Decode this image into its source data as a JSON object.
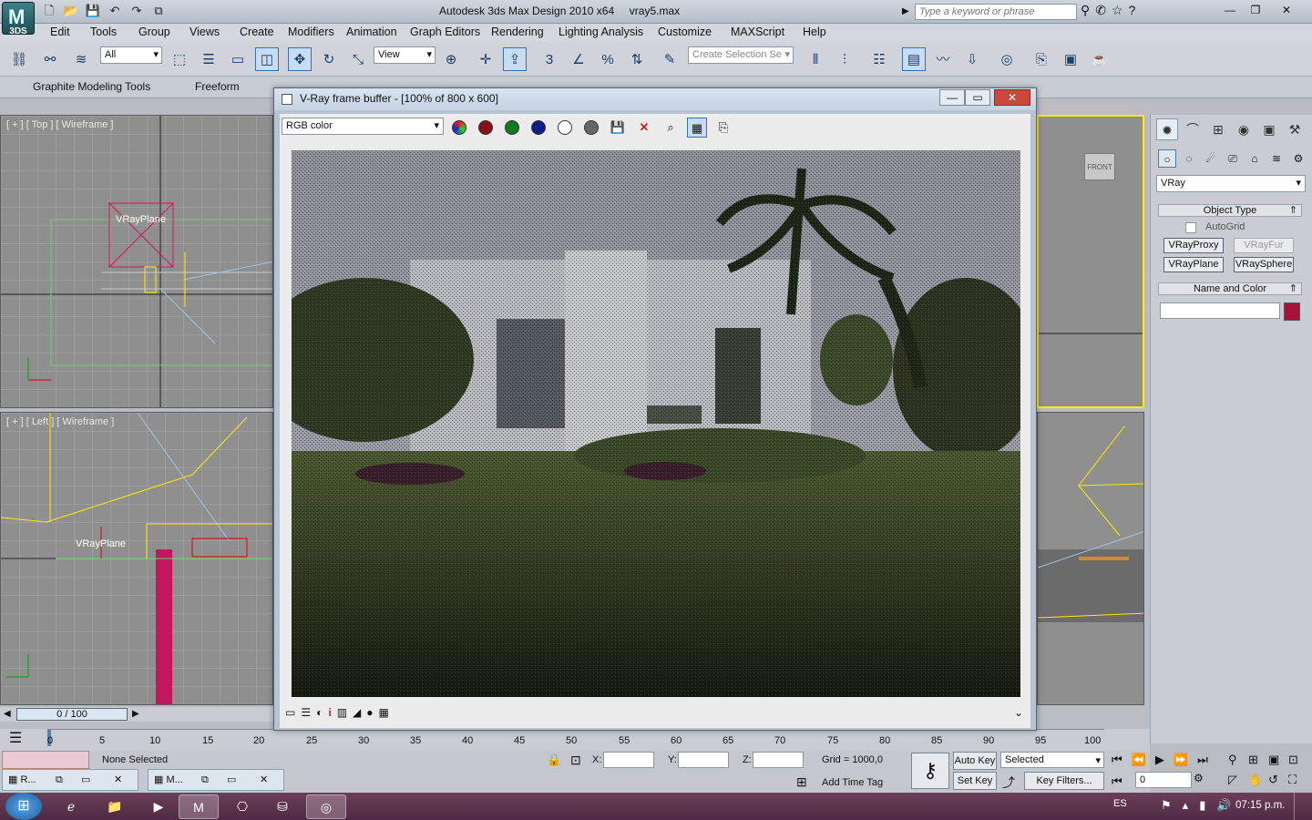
{
  "app": {
    "title": "Autodesk 3ds Max Design 2010 x64",
    "file": "vray5.max",
    "logo_text": "3DS",
    "search_placeholder": "Type a keyword or phrase"
  },
  "menus": [
    "Edit",
    "Tools",
    "Group",
    "Views",
    "Create",
    "Modifiers",
    "Animation",
    "Graph Editors",
    "Rendering",
    "Lighting Analysis",
    "Customize",
    "MAXScript",
    "Help"
  ],
  "toolbar": {
    "selection_filter": "All",
    "ref_coord": "View",
    "named_selection_placeholder": "Create Selection Se",
    "snap_label": "3"
  },
  "ribbon": {
    "tabs": [
      "Graphite Modeling Tools",
      "Freeform"
    ]
  },
  "viewports": {
    "top_label": "[ + ] [ Top ] [ Wireframe ]",
    "left_label": "[ + ] [ Left ] [ Wireframe ]",
    "object_label": "VRayPlane",
    "viewcube_label": "FRONT"
  },
  "vfb": {
    "title": "V-Ray frame buffer - [100% of 800 x 600]",
    "channel": "RGB color",
    "colors": {
      "red": "#8a0f1a",
      "green": "#0f7a1f",
      "blue": "#0f1f8a"
    }
  },
  "command_panel": {
    "renderer_dropdown": "VRay",
    "object_type_header": "Object Type",
    "autogrid": "AutoGrid",
    "buttons": [
      "VRayProxy",
      "VRayFur",
      "VRayPlane",
      "VRaySphere"
    ],
    "name_color_header": "Name and Color",
    "object_color": "#a5123a"
  },
  "timeline": {
    "frame_display": "0 / 100",
    "ticks": [
      "0",
      "5",
      "10",
      "15",
      "20",
      "25",
      "30",
      "35",
      "40",
      "45",
      "50",
      "55",
      "60",
      "65",
      "70",
      "75",
      "80",
      "85",
      "90",
      "95",
      "100"
    ]
  },
  "status": {
    "selection": "None Selected",
    "x_label": "X:",
    "y_label": "Y:",
    "z_label": "Z:",
    "grid": "Grid = 1000,0",
    "add_time_tag": "Add Time Tag",
    "auto_key": "Auto Key",
    "set_key": "Set Key",
    "key_mode": "Selected",
    "key_filters": "Key Filters...",
    "frame": "0"
  },
  "mini_windows": [
    {
      "label": "R..."
    },
    {
      "label": "M..."
    }
  ],
  "taskbar": {
    "language": "ES",
    "time": "07:15 p.m."
  }
}
